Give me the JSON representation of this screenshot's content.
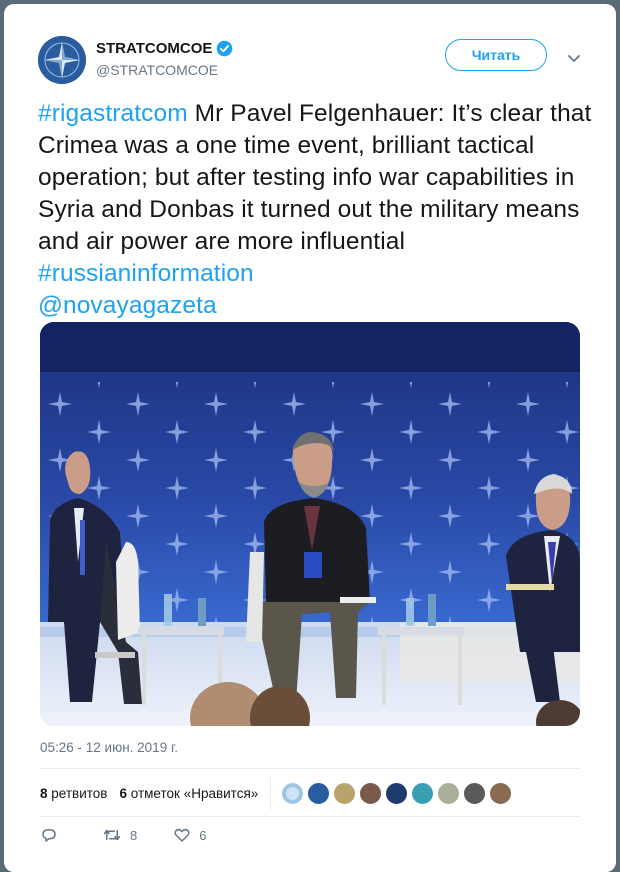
{
  "tweet": {
    "user_name": "STRATCOMCOE",
    "handle": "@STRATCOMCOE",
    "follow_label": "Читать",
    "text_hashtag_1": "#rigastratcom",
    "text_body": " Mr Pavel Felgenhauer: It’s clear that Crimea was a one time event, brilliant tactical operation; but after testing info war capabilities in Syria and Donbas it turned out the military means and air power are more influential ",
    "text_hashtag_2": "#russianinformation",
    "text_mention": "@novayagazeta",
    "timestamp": "05:26 - 12 июн. 2019 г.",
    "retweets_count": "8",
    "retweets_label": "ретвитов",
    "likes_count": "6",
    "likes_label": "отметок «Нравится»",
    "reply_count": "",
    "retweet_action_count": "8",
    "like_action_count": "6"
  },
  "colors": {
    "link": "#1da1f2",
    "text": "#14171a",
    "muted": "#657786"
  },
  "icons": [
    "verified-icon",
    "chevron-down-icon",
    "reply-icon",
    "retweet-icon",
    "like-icon"
  ]
}
